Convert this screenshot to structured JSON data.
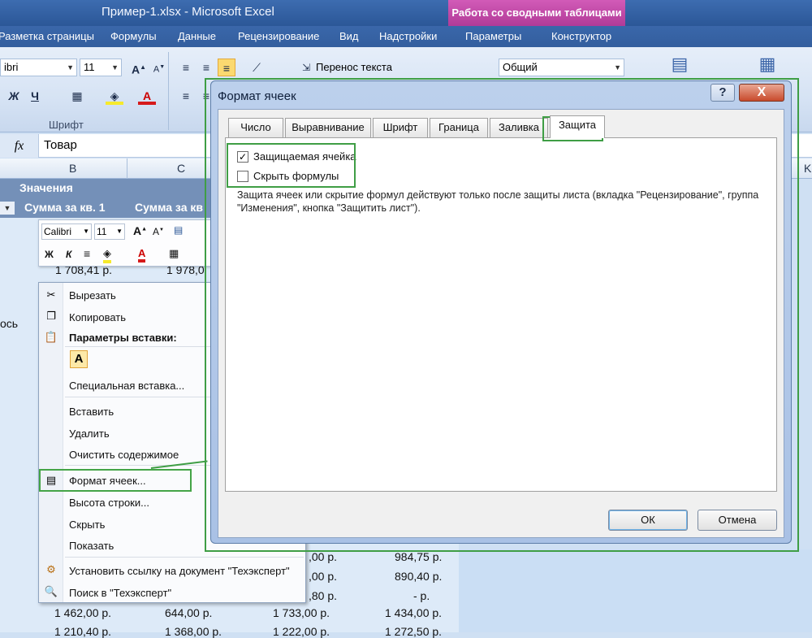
{
  "window": {
    "title": "Пример-1.xlsx  -  Microsoft Excel",
    "context_tab_group": "Работа со сводными таблицами"
  },
  "ribbon_tabs": [
    "Разметка страницы",
    "Формулы",
    "Данные",
    "Рецензирование",
    "Вид",
    "Надстройки",
    "Параметры",
    "Конструктор"
  ],
  "ribbon": {
    "font_name": "ibri",
    "font_size": "11",
    "wrap_text": "Перенос текста",
    "number_format": "Общий",
    "group_font": "Шрифт",
    "bold": "Ж",
    "italic": "К",
    "underline": "Ч"
  },
  "formula_bar": {
    "fx": "fx",
    "value": "Товар"
  },
  "grid": {
    "columns": [
      "B",
      "C",
      "K"
    ],
    "pivot_row1": "Значения",
    "pivot_col_b": "Сумма за кв. 1",
    "pivot_col_c": "Сумма за кв",
    "left_fragment": "ось",
    "partial_row_b": "1 708,41 р.",
    "partial_row_c": "1 978,0",
    "rows": [
      {
        "c": ",00 р.",
        "d": "984,75 р."
      },
      {
        "c": ",00 р.",
        "d": "890,40 р."
      },
      {
        "c": ",80 р.",
        "d": "-    р."
      },
      {
        "a": "1 462,00 р.",
        "b": "644,00 р.",
        "c": "1 733,00 р.",
        "d": "1 434,00 р."
      },
      {
        "a": "1 210,40 р.",
        "b": "1 368,00 р.",
        "c": "1 222,00 р.",
        "d": "1 272,50 р."
      }
    ]
  },
  "mini_toolbar": {
    "font": "Calibri",
    "size": "11",
    "bold": "Ж",
    "italic": "К"
  },
  "context_menu": {
    "cut": "Вырезать",
    "copy": "Копировать",
    "paste_options": "Параметры вставки:",
    "paste_glyph": "A",
    "special_paste": "Специальная вставка...",
    "insert": "Вставить",
    "delete": "Удалить",
    "clear": "Очистить содержимое",
    "format_cells": "Формат ячеек...",
    "row_height": "Высота строки...",
    "hide": "Скрыть",
    "show": "Показать",
    "set_link": "Установить ссылку на документ \"Техэксперт\"",
    "search": "Поиск в \"Техэксперт\""
  },
  "dialog": {
    "title": "Формат ячеек",
    "help": "?",
    "close": "X",
    "tabs": [
      "Число",
      "Выравнивание",
      "Шрифт",
      "Граница",
      "Заливка",
      "Защита"
    ],
    "active_tab": "Защита",
    "protected_cell": "Защищаемая ячейка",
    "protected_checked": true,
    "hide_formulas": "Скрыть формулы",
    "hide_checked": false,
    "info": "Защита ячеек или скрытие формул действуют только после защиты листа (вкладка \"Рецензирование\", группа \"Изменения\", кнопка \"Защитить лист\").",
    "ok": "ОК",
    "cancel": "Отмена",
    "check_mark": "✓"
  },
  "colors": {
    "highlight": "#3f9e45",
    "title_bar": "#2b5797",
    "context_tab": "#c24aa8"
  }
}
